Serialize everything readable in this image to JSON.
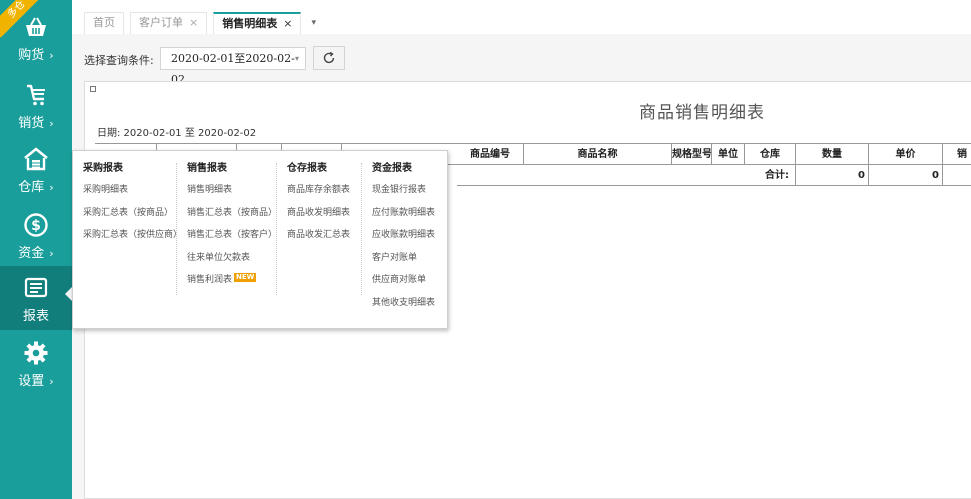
{
  "ribbon": "多仓",
  "sidebar": {
    "items": [
      {
        "label": "购货",
        "icon": "basket-icon"
      },
      {
        "label": "销货",
        "icon": "cart-icon"
      },
      {
        "label": "仓库",
        "icon": "warehouse-icon"
      },
      {
        "label": "资金",
        "icon": "dollar-circle-icon"
      },
      {
        "label": "报表",
        "icon": "report-icon"
      },
      {
        "label": "设置",
        "icon": "gear-icon"
      }
    ],
    "active": "报表",
    "chevron": "›",
    "colors": {
      "background": "#199e9b",
      "active": "#127e7c"
    }
  },
  "tabs": [
    {
      "label": "首页"
    },
    {
      "label": "客户订单",
      "close": "×"
    },
    {
      "label": "销售明细表",
      "close": "×"
    }
  ],
  "tab_caret": "▾",
  "filter": {
    "label": "选择查询条件:",
    "date_range": "2020-02-01至2020-02-02",
    "caret": "▾",
    "refresh_icon": "refresh-icon"
  },
  "report": {
    "title": "商品销售明细表",
    "date_line": "日期: 2020-02-01 至 2020-02-02",
    "columns": [
      "商品编号",
      "商品名称",
      "规格型号",
      "单位",
      "仓库",
      "数量",
      "单价",
      "销"
    ],
    "total_label": "合计:",
    "total_values": {
      "quantity": "0",
      "unit_price": "0"
    }
  },
  "menu": {
    "columns": [
      {
        "title": "采购报表",
        "items": [
          {
            "label": "采购明细表"
          },
          {
            "label": "采购汇总表（按商品）"
          },
          {
            "label": "采购汇总表（按供应商）"
          }
        ]
      },
      {
        "title": "销售报表",
        "items": [
          {
            "label": "销售明细表"
          },
          {
            "label": "销售汇总表（按商品）"
          },
          {
            "label": "销售汇总表（按客户）"
          },
          {
            "label": "往来单位欠款表"
          },
          {
            "label": "销售利润表",
            "badge": "NEW"
          }
        ]
      },
      {
        "title": "仓存报表",
        "items": [
          {
            "label": "商品库存余额表"
          },
          {
            "label": "商品收发明细表"
          },
          {
            "label": "商品收发汇总表"
          }
        ]
      },
      {
        "title": "资金报表",
        "items": [
          {
            "label": "现金银行报表"
          },
          {
            "label": "应付账款明细表"
          },
          {
            "label": "应收账款明细表"
          },
          {
            "label": "客户对账单"
          },
          {
            "label": "供应商对账单"
          },
          {
            "label": "其他收支明细表"
          }
        ]
      }
    ]
  }
}
